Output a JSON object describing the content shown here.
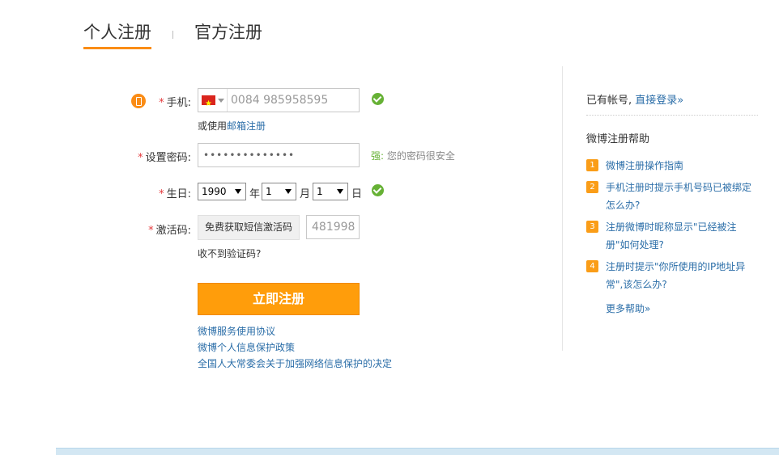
{
  "tabs": {
    "personal": "个人注册",
    "official": "官方注册"
  },
  "form": {
    "phone": {
      "label": "手机:",
      "required_mark": "*",
      "country_code_value": "0084 985958595",
      "alt_prefix": "或使用",
      "alt_link": "邮箱注册"
    },
    "password": {
      "label": "设置密码:",
      "required_mark": "*",
      "value": "••••••••••••••",
      "strength_level": "强:",
      "strength_message": "您的密码很安全"
    },
    "birthday": {
      "label": "生日:",
      "required_mark": "*",
      "year": "1990",
      "year_unit": "年",
      "month": "1",
      "month_unit": "月",
      "day": "1",
      "day_unit": "日"
    },
    "activation": {
      "label": "激活码:",
      "required_mark": "*",
      "sms_button": "免费获取短信激活码",
      "code_value": "481998",
      "not_received": "收不到验证码?"
    },
    "submit_label": "立即注册",
    "agreements": [
      "微博服务使用协议",
      "微博个人信息保护政策",
      "全国人大常委会关于加强网络信息保护的决定"
    ]
  },
  "sidebar": {
    "has_account": "已有帐号,",
    "login_link": "直接登录»",
    "help_title": "微博注册帮助",
    "help_items": [
      {
        "num": "1",
        "text": "微博注册操作指南"
      },
      {
        "num": "2",
        "text": "手机注册时提示手机号码已被绑定怎么办?"
      },
      {
        "num": "3",
        "text": "注册微博时昵称显示\"已经被注册\"如何处理?"
      },
      {
        "num": "4",
        "text": "注册时提示\"你所使用的IP地址异常\",该怎么办?"
      }
    ],
    "more_help": "更多帮助»"
  },
  "colors": {
    "accent": "#fa8c16",
    "button": "#ff9d0b",
    "link": "#2b6ea8",
    "success": "#66b135",
    "required": "#e4393c"
  },
  "icons": {
    "step": "mobile-phone-icon",
    "ok": "check-circle-icon",
    "flag": "vietnam-flag-icon"
  }
}
